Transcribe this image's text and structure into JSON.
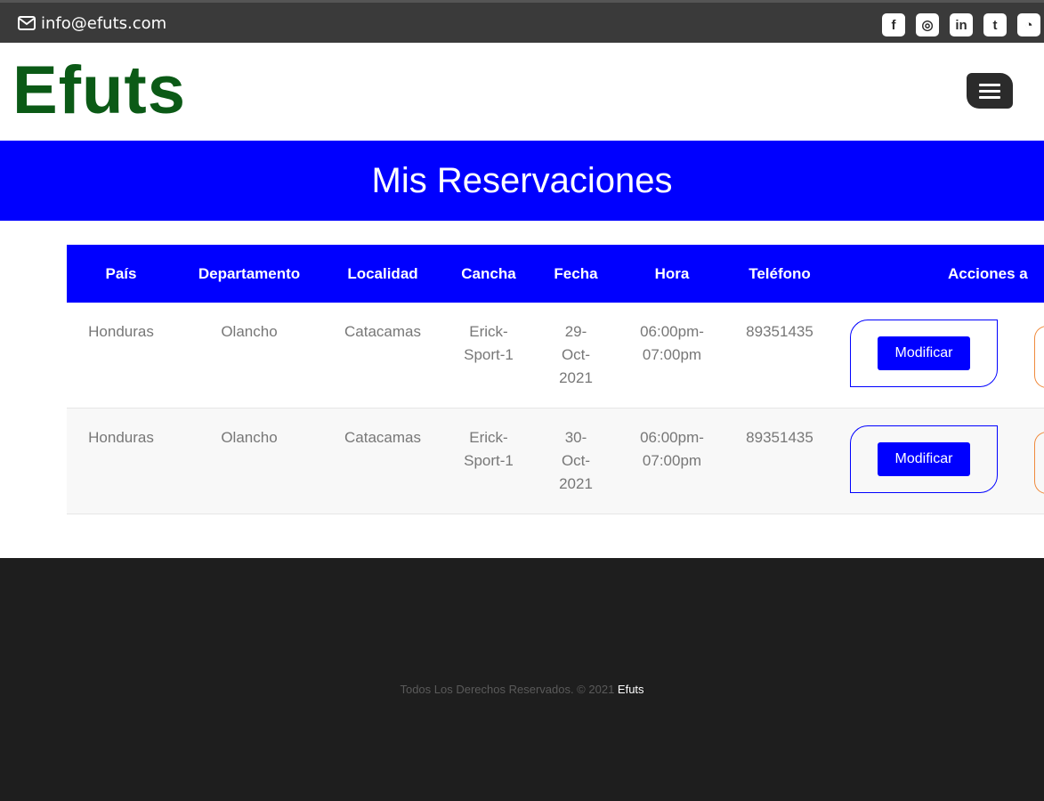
{
  "topbar": {
    "email": "info@efuts.com",
    "socials": [
      {
        "icon": "facebook-icon",
        "glyph": "f"
      },
      {
        "icon": "instagram-icon",
        "glyph": "◎"
      },
      {
        "icon": "linkedin-icon",
        "glyph": "in"
      },
      {
        "icon": "twitter-icon",
        "glyph": "t"
      },
      {
        "icon": "rss-icon",
        "glyph": "◔"
      }
    ]
  },
  "header": {
    "logo": "Efuts"
  },
  "banner": {
    "title": "Mis Reservaciones"
  },
  "table": {
    "headers": [
      "País",
      "Departamento",
      "Localidad",
      "Cancha",
      "Fecha",
      "Hora",
      "Teléfono",
      "Acciones a"
    ],
    "rows": [
      {
        "pais": "Honduras",
        "departamento": "Olancho",
        "localidad": "Catacamas",
        "cancha": "Erick-\nSport-1",
        "fecha": "29-\nOct-\n2021",
        "hora": "06:00pm-\n07:00pm",
        "telefono": "89351435",
        "action": "Modificar"
      },
      {
        "pais": "Honduras",
        "departamento": "Olancho",
        "localidad": "Catacamas",
        "cancha": "Erick-\nSport-1",
        "fecha": "30-\nOct-\n2021",
        "hora": "06:00pm-\n07:00pm",
        "telefono": "89351435",
        "action": "Modificar"
      }
    ]
  },
  "footer": {
    "copyright": "Todos Los Derechos Reservados. © 2021 ",
    "brand": "Efuts"
  },
  "colors": {
    "accent": "#0000ff",
    "logo": "#0b5a16",
    "footer": "#1e1e1e",
    "topbar": "#3a3a3a",
    "secondary": "#f08a3c"
  }
}
